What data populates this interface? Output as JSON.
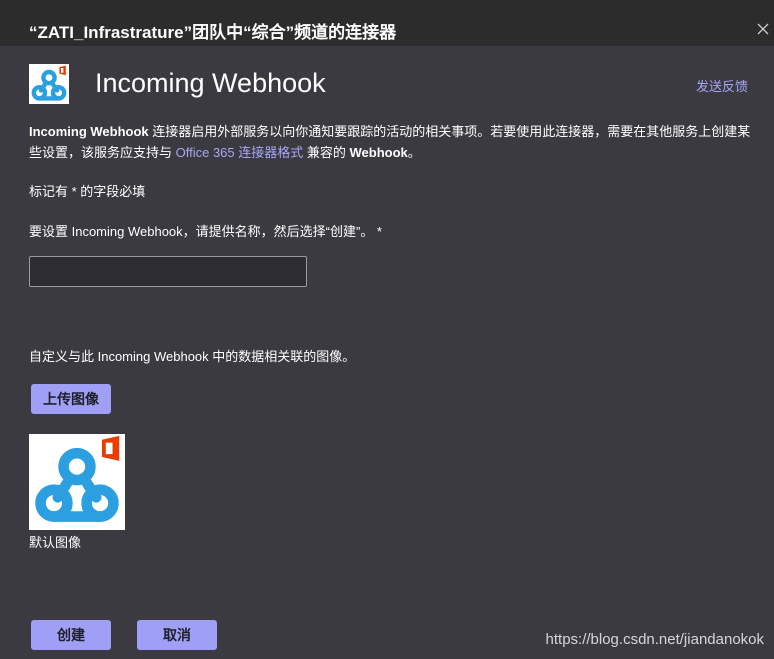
{
  "dialog": {
    "title": "“ZATI_Infrastrature”团队中“综合”频道的连接器",
    "close_icon": "close-icon"
  },
  "header": {
    "heading": "Incoming Webhook",
    "feedback_link": "发送反馈",
    "logo_icon": "webhook-office-logo"
  },
  "description": {
    "part1_bold": "Incoming Webhook",
    "part2": " 连接器启用外部服务以向你通知要跟踪的活动的相关事项。若要使用此连接器，需要在其他服务上创建某些设置，该服务应支持与 ",
    "link": "Office 365 连接器格式",
    "part3": " 兼容的 ",
    "part4_bold": "Webhook",
    "part5": "。"
  },
  "form": {
    "required_note": "标记有 * 的字段必填",
    "name_label": "要设置 Incoming Webhook，请提供名称，然后选择“创建”。 *",
    "name_value": "",
    "image_label": "自定义与此 Incoming Webhook 中的数据相关联的图像。",
    "upload_button": "上传图像",
    "default_image_caption": "默认图像"
  },
  "actions": {
    "create": "创建",
    "cancel": "取消"
  },
  "watermark": "https://blog.csdn.net/jiandanokok",
  "colors": {
    "background": "#3b3a41",
    "titlebar": "#2d2c2c",
    "accent": "#9e9ff5",
    "link": "#a6a7f5",
    "webhook_blue": "#2b9fe0",
    "office_red": "#eb3c00"
  }
}
